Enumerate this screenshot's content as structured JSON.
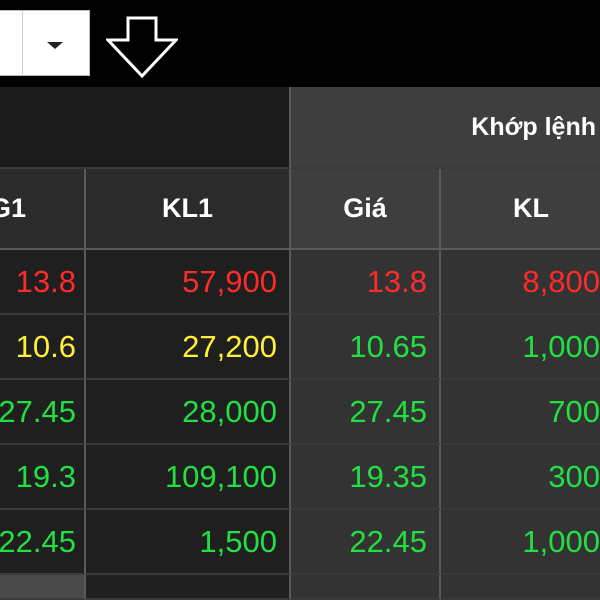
{
  "toolbar": {
    "select_icon": "chevron-down-icon",
    "download_icon": "arrow-down-outline-icon"
  },
  "header": {
    "group_label": "Khớp lệnh",
    "columns": [
      "G1",
      "KL1",
      "Giá",
      "KL"
    ]
  },
  "rows": [
    {
      "g1": "13.8",
      "kl1": "57,900",
      "gia": "13.8",
      "kl": "8,800",
      "g1_color": "#ff2a2a",
      "kl1_color": "#ff2a2a",
      "gia_color": "#ff2a2a",
      "kl_color": "#ff2a2a"
    },
    {
      "g1": "10.6",
      "kl1": "27,200",
      "gia": "10.65",
      "kl": "1,000",
      "g1_color": "#ffee3a",
      "kl1_color": "#ffee3a",
      "gia_color": "#22e043",
      "kl_color": "#22e043"
    },
    {
      "g1": "27.45",
      "kl1": "28,000",
      "gia": "27.45",
      "kl": "700",
      "g1_color": "#22e043",
      "kl1_color": "#22e043",
      "gia_color": "#22e043",
      "kl_color": "#22e043"
    },
    {
      "g1": "19.3",
      "kl1": "109,100",
      "gia": "19.35",
      "kl": "300",
      "g1_color": "#22e043",
      "kl1_color": "#22e043",
      "gia_color": "#22e043",
      "kl_color": "#22e043"
    },
    {
      "g1": "22.45",
      "kl1": "1,500",
      "gia": "22.45",
      "kl": "1,000",
      "g1_color": "#22e043",
      "kl1_color": "#22e043",
      "gia_color": "#22e043",
      "kl_color": "#22e043"
    }
  ]
}
